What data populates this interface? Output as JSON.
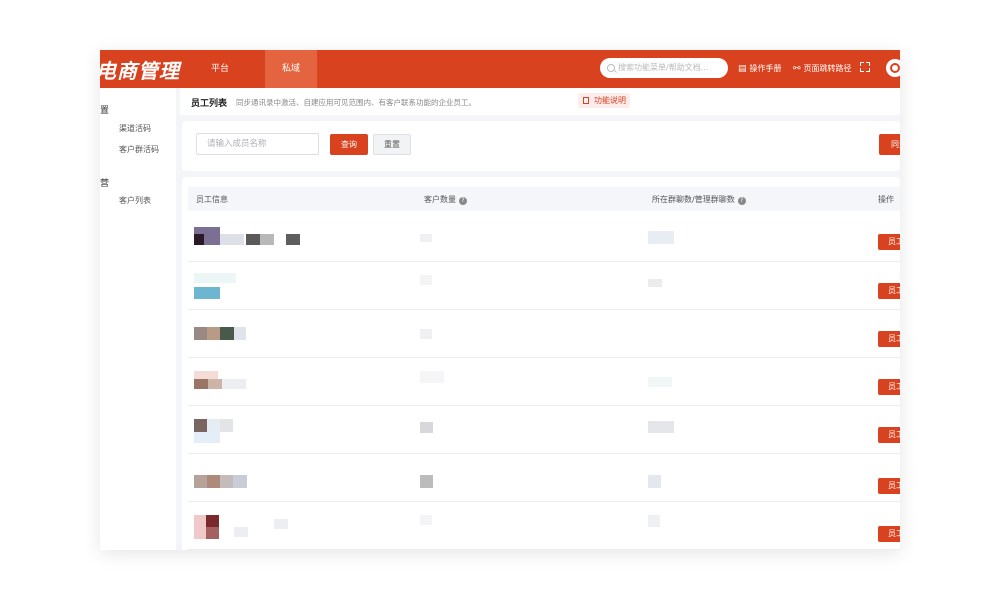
{
  "header": {
    "logo": "电商管理",
    "nav": [
      {
        "label": "平台"
      },
      {
        "label": "私域"
      }
    ],
    "search_placeholder": "搜索功能菜单/帮助文档...",
    "manual": "操作手册",
    "page_path": "页面跳转路径"
  },
  "sidebar": {
    "groups": [
      {
        "label": "置",
        "items": [
          {
            "label": "渠道活码"
          },
          {
            "label": "客户群活码"
          }
        ]
      },
      {
        "label": "营",
        "items": [
          {
            "label": "客户列表"
          }
        ]
      }
    ]
  },
  "breadcrumb": {
    "title": "员工列表",
    "desc": "同步通讯录中激活、自建应用可见范围内、有客户联系功能的企业员工。",
    "func_link": "功能说明"
  },
  "filter": {
    "placeholder": "请输入成员名称",
    "query": "查询",
    "reset": "重置",
    "sync": "同步"
  },
  "table": {
    "columns": [
      "员工信息",
      "客户数量",
      "所在群聊数/管理群聊数",
      "操作"
    ],
    "row_action": "员工",
    "rows": 7
  },
  "colors": {
    "brand": "#d9421f",
    "nav_active": "#e4643f"
  }
}
